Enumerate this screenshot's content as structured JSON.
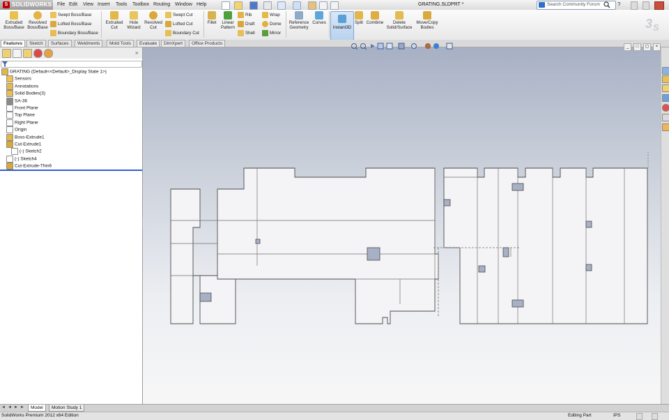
{
  "app": {
    "brand": "SOLIDWORKS",
    "title": "GRATING.SLDPRT *"
  },
  "menu": [
    "File",
    "Edit",
    "View",
    "Insert",
    "Tools",
    "Toolbox",
    "Routing",
    "Window",
    "Help"
  ],
  "search": {
    "placeholder": "Search Community Forum"
  },
  "toolbar": {
    "extruded_boss": "Extruded\nBoss/Base",
    "revolved_boss": "Revolved\nBoss/Base",
    "swept_boss": "Swept Boss/Base",
    "lofted_boss": "Lofted Boss/Base",
    "boundary_boss": "Boundary Boss/Base",
    "extruded_cut": "Extruded\nCut",
    "hole_wizard": "Hole\nWizard",
    "revolved_cut": "Revolved\nCut",
    "swept_cut": "Swept Cut",
    "lofted_cut": "Lofted Cut",
    "boundary_cut": "Boundary Cut",
    "fillet": "Fillet",
    "linear_pattern": "Linear\nPattern",
    "rib": "Rib",
    "draft": "Draft",
    "shell": "Shell",
    "wrap": "Wrap",
    "dome": "Dome",
    "mirror": "Mirror",
    "reference_geometry": "Reference\nGeometry",
    "curves": "Curves",
    "instant3d": "Instant3D",
    "split": "Split",
    "combine": "Combine",
    "delete_solid": "Delete\nSolid/Surface",
    "move_copy": "Move/Copy\nBodies"
  },
  "tabs": [
    "Features",
    "Sketch",
    "Surfaces",
    "Weldments",
    "Mold Tools",
    "Evaluate",
    "DimXpert",
    "Office Products"
  ],
  "tree": [
    {
      "label": "GRATING  (Default<<Default>_Display State 1>)",
      "indent": 0,
      "icon": "part-icon"
    },
    {
      "label": "Sensors",
      "indent": 1,
      "icon": "sensor-icon"
    },
    {
      "label": "Annotations",
      "indent": 1,
      "icon": "annotation-icon"
    },
    {
      "label": "Solid Bodies(3)",
      "indent": 1,
      "icon": "solid-bodies-icon"
    },
    {
      "label": "SA-36",
      "indent": 1,
      "icon": "material-icon"
    },
    {
      "label": "Front Plane",
      "indent": 1,
      "icon": "plane-icon"
    },
    {
      "label": "Top Plane",
      "indent": 1,
      "icon": "plane-icon"
    },
    {
      "label": "Right Plane",
      "indent": 1,
      "icon": "plane-icon"
    },
    {
      "label": "Origin",
      "indent": 1,
      "icon": "origin-icon"
    },
    {
      "label": "Boss-Extrude1",
      "indent": 1,
      "icon": "boss-extrude-icon"
    },
    {
      "label": "Cut-Extrude1",
      "indent": 1,
      "icon": "cut-extrude-icon"
    },
    {
      "label": "(-) Sketch2",
      "indent": 2,
      "icon": "sketch-icon"
    },
    {
      "label": "(-) Sketch4",
      "indent": 1,
      "icon": "sketch-icon"
    },
    {
      "label": "Cut-Extrude-Thin6",
      "indent": 1,
      "icon": "cut-extrude-icon"
    }
  ],
  "bottom_tabs": [
    "Model",
    "Motion Study 1"
  ],
  "status": {
    "edition": "SolidWorks Premium 2012 x64 Edition",
    "mode": "Editing Part",
    "units": "IPS"
  },
  "colors": {
    "accent": "#2f5fd0",
    "brand": "#c00000",
    "part_face": "#f4f4f6",
    "part_edge": "#4a4a4a"
  }
}
